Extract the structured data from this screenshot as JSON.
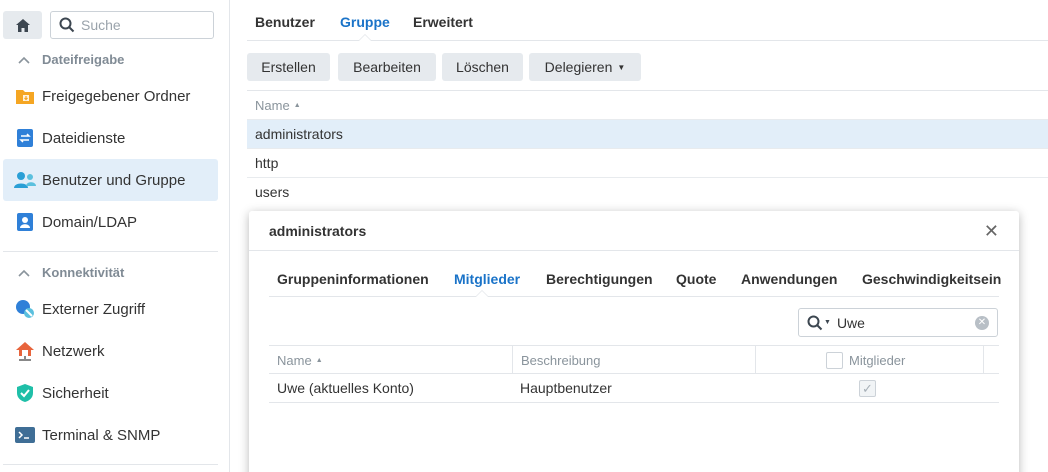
{
  "sidebar": {
    "search_placeholder": "Suche",
    "sections": [
      {
        "label": "Dateifreigabe"
      },
      {
        "label": "Konnektivität"
      }
    ],
    "items": [
      {
        "label": "Freigegebener Ordner",
        "icon": "folder-icon"
      },
      {
        "label": "Dateidienste",
        "icon": "file-services-icon"
      },
      {
        "label": "Benutzer und Gruppe",
        "icon": "users-icon",
        "active": true
      },
      {
        "label": "Domain/LDAP",
        "icon": "domain-icon"
      },
      {
        "label": "Externer Zugriff",
        "icon": "external-access-icon"
      },
      {
        "label": "Netzwerk",
        "icon": "network-icon"
      },
      {
        "label": "Sicherheit",
        "icon": "shield-icon"
      },
      {
        "label": "Terminal & SNMP",
        "icon": "terminal-icon"
      }
    ]
  },
  "main": {
    "tabs": [
      {
        "label": "Benutzer"
      },
      {
        "label": "Gruppe",
        "active": true
      },
      {
        "label": "Erweitert"
      }
    ],
    "toolbar": {
      "create": "Erstellen",
      "edit": "Bearbeiten",
      "delete": "Löschen",
      "delegate": "Delegieren"
    },
    "table": {
      "header_name": "Name",
      "rows": [
        "administrators",
        "http",
        "users"
      ]
    }
  },
  "dialog": {
    "title": "administrators",
    "tabs": [
      {
        "label": "Gruppeninformationen"
      },
      {
        "label": "Mitglieder",
        "active": true
      },
      {
        "label": "Berechtigungen"
      },
      {
        "label": "Quote"
      },
      {
        "label": "Anwendungen"
      },
      {
        "label": "Geschwindigkeitsein"
      }
    ],
    "search_value": "Uwe",
    "columns": [
      "Name",
      "Beschreibung",
      "Mitglieder"
    ],
    "rows": [
      {
        "name": "Uwe (aktuelles Konto)",
        "description": "Hauptbenutzer",
        "member": true
      }
    ]
  },
  "colors": {
    "accent": "#1a73c8",
    "selection": "#e2eef9",
    "button_bg": "#e6eaee"
  }
}
